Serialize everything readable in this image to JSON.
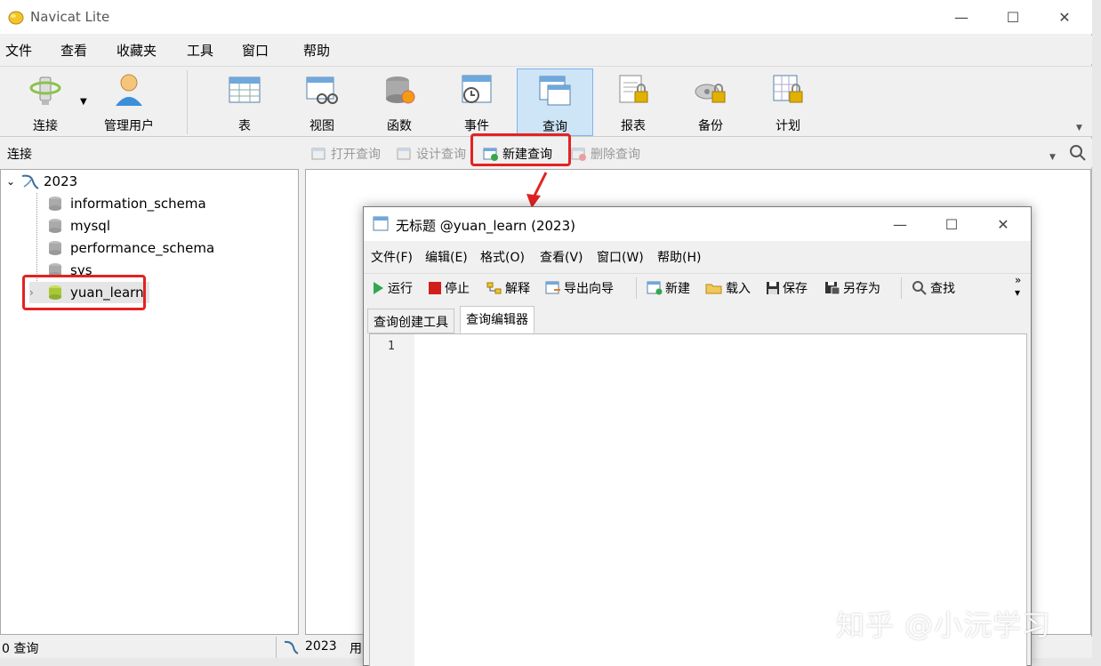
{
  "window": {
    "title": "Navicat Lite",
    "controls": [
      "minimize",
      "maximize",
      "close"
    ]
  },
  "menu": [
    "文件",
    "查看",
    "收藏夹",
    "工具",
    "窗口",
    "帮助"
  ],
  "toolbar": [
    {
      "label": "连接",
      "icon": "connection-icon"
    },
    {
      "label": "管理用户",
      "icon": "user-icon"
    },
    {
      "label": "表",
      "icon": "table-icon"
    },
    {
      "label": "视图",
      "icon": "view-icon"
    },
    {
      "label": "函数",
      "icon": "function-icon"
    },
    {
      "label": "事件",
      "icon": "event-icon"
    },
    {
      "label": "查询",
      "icon": "query-icon",
      "active": true
    },
    {
      "label": "报表",
      "icon": "report-icon"
    },
    {
      "label": "备份",
      "icon": "backup-icon"
    },
    {
      "label": "计划",
      "icon": "schedule-icon"
    }
  ],
  "subbar": {
    "title": "连接",
    "actions": [
      {
        "label": "打开查询",
        "enabled": false
      },
      {
        "label": "设计查询",
        "enabled": false
      },
      {
        "label": "新建查询",
        "enabled": true
      },
      {
        "label": "删除查询",
        "enabled": false
      }
    ]
  },
  "tree": {
    "connection": "2023",
    "databases": [
      "information_schema",
      "mysql",
      "performance_schema",
      "sys",
      "yuan_learn"
    ],
    "selected": "yuan_learn"
  },
  "status": {
    "left": "0 查询",
    "connection": "2023",
    "user": "用"
  },
  "query_window": {
    "title": "无标题 @yuan_learn (2023)",
    "menu": [
      "文件(F)",
      "编辑(E)",
      "格式(O)",
      "查看(V)",
      "窗口(W)",
      "帮助(H)"
    ],
    "toolbar": [
      "运行",
      "停止",
      "解释",
      "导出向导",
      "新建",
      "载入",
      "保存",
      "另存为",
      "查找"
    ],
    "tabs": [
      "查询创建工具",
      "查询编辑器"
    ],
    "active_tab": "查询编辑器",
    "line_number": "1"
  },
  "watermark": "知乎 @小沅学习",
  "colors": {
    "highlight": "#e32222",
    "active_tool": "#cde5f7"
  }
}
